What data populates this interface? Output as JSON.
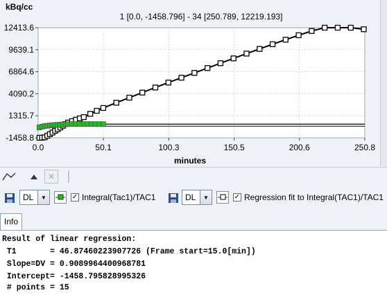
{
  "chart": {
    "y_unit": "kBq/cc",
    "x_label": "minutes",
    "header": "1 [0.0, -1458.796] - 34 [250.789, 12219.193]",
    "y_ticks": [
      "12413.6",
      "9639.1",
      "6864.6",
      "4090.2",
      "1315.7",
      "-1458.8"
    ],
    "x_ticks": [
      "0.0",
      "50.1",
      "100.3",
      "150.5",
      "200.6",
      "250.8"
    ]
  },
  "chart_data": {
    "type": "scatter",
    "xlabel": "minutes",
    "ylabel": "kBq/cc",
    "xlim": [
      0.0,
      250.8
    ],
    "ylim": [
      -1458.8,
      12413.6
    ],
    "grid": true,
    "series": [
      {
        "name": "Integral(Tac1)/TAC1",
        "color": "#22bb22",
        "x": [
          1,
          3,
          5,
          7,
          9,
          11,
          13,
          15,
          17,
          19,
          21,
          23,
          26,
          29,
          32,
          35,
          38,
          41,
          44,
          47,
          50
        ],
        "y": [
          -150,
          -50,
          20,
          60,
          100,
          130,
          160,
          190,
          210,
          230,
          250,
          265,
          275,
          280,
          280,
          278,
          275,
          272,
          270,
          268,
          265
        ]
      },
      {
        "name": "Regression fit to Integral(TAC1)/TAC1",
        "color": "#000000",
        "x": [
          1,
          3,
          5,
          7,
          9,
          11,
          13,
          15,
          17,
          19,
          21,
          23,
          26,
          29,
          32,
          35,
          40,
          45,
          50,
          60,
          70,
          80,
          90,
          100,
          110,
          120,
          130,
          140,
          150,
          160,
          170,
          180,
          190,
          200,
          210,
          220,
          230,
          240,
          250
        ],
        "y": [
          -1458,
          -1440,
          -1400,
          -1200,
          -1000,
          -800,
          -580,
          -380,
          -160,
          60,
          270,
          460,
          640,
          820,
          990,
          1150,
          1560,
          1940,
          2300,
          2960,
          3600,
          4240,
          4880,
          5500,
          6110,
          6720,
          7330,
          7940,
          8550,
          9150,
          9740,
          10330,
          10900,
          11460,
          12000,
          12540,
          13060,
          13580,
          12219
        ]
      }
    ]
  },
  "toolbar": {
    "icons": [
      "line-style-icon",
      "triangle-up-icon",
      "close-icon",
      "divider-icon"
    ]
  },
  "series_controls": [
    {
      "combo_value": "DL",
      "checked": true,
      "label": "Integral(Tac1)/TAC1",
      "symbol_color": "#22bb22"
    },
    {
      "combo_value": "DL",
      "checked": true,
      "label": "Regression fit to Integral(TAC1)/TAC1",
      "symbol_color": "#000000"
    }
  ],
  "tabs": {
    "info": "Info"
  },
  "info": {
    "lines": [
      "Result of linear regression:",
      " T1       = 46.87460223907726 (Frame start=15.0[min])",
      " Slope=DV = 0.9089964400968781",
      " Intercept= -1458.795828995326",
      " # points = 15"
    ]
  }
}
